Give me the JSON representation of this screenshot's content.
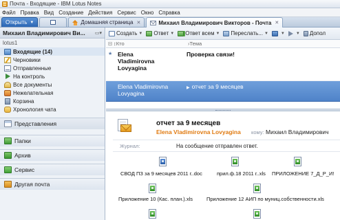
{
  "window": {
    "title": "Почта - Входящие - IBM Lotus Notes"
  },
  "menu": [
    "Файл",
    "Правка",
    "Вид",
    "Создание",
    "Действия",
    "Сервис",
    "Окно",
    "Справка"
  ],
  "tabs": {
    "open_label": "Открыть",
    "home_label": "Домашняя страница",
    "mail_label": "Михаил Владимирович Викторов - Почта"
  },
  "sidebar": {
    "owner": "Михаил Владимирович Ви...",
    "database": "lotus1",
    "folders": [
      {
        "label": "Входящие (14)",
        "icon": "inbox-icon",
        "selected": true
      },
      {
        "label": "Черновики",
        "icon": "drafts-icon"
      },
      {
        "label": "Отправленные",
        "icon": "sent-icon"
      },
      {
        "label": "На контроль",
        "icon": "follow-up-icon"
      },
      {
        "label": "Все документы",
        "icon": "all-documents-icon"
      },
      {
        "label": "Нежелательная",
        "icon": "junk-icon"
      },
      {
        "label": "Корзина",
        "icon": "trash-icon"
      },
      {
        "label": "Хронология чата",
        "icon": "chat-history-icon"
      }
    ],
    "sections": {
      "views": "Представления",
      "folders": "Папки",
      "archive": "Архив",
      "service": "Сервис",
      "other_mail": "Другая почта"
    }
  },
  "toolbar": {
    "create": "Создать",
    "reply": "Ответ",
    "reply_all": "Ответ всем",
    "forward": "Переслать...",
    "more": "Допол"
  },
  "columns": {
    "from": "Кто",
    "subject": "Тема"
  },
  "messages": [
    {
      "from_line1": "Elena",
      "from_line2": "Vladimirovna",
      "from_line3": "Lovyagina",
      "subject": "Проверка связи!",
      "unread": true
    },
    {
      "from_line1": "Elena Vladimirovna",
      "from_line2": "Lovyagina",
      "subject": "отчет за 9 месяцев",
      "selected": true
    }
  ],
  "preview": {
    "subject": "отчет за 9 месяцев",
    "from": "Elena Vladimirovna Lovyagina",
    "to_label": "кому:",
    "to": "Михаил Владимирович",
    "journal_label": "Журнал:",
    "journal": "На сообщение отправлен ответ.",
    "attachments": [
      "СВОД ПЗ за 9 месяцев 2011 г..doc",
      "прил.ф.18 2011 г..xls",
      "ПРИЛОЖЕНИЕ 7_Д_Р_И!",
      "Приложение 10 (Кас. план.).xls",
      "Приложение 12 АИП по муниц.собственности.xls"
    ]
  },
  "colors": {
    "accent": "#4f83c9",
    "from_highlight": "#e07a10",
    "tab_open": "#2b66b4"
  }
}
